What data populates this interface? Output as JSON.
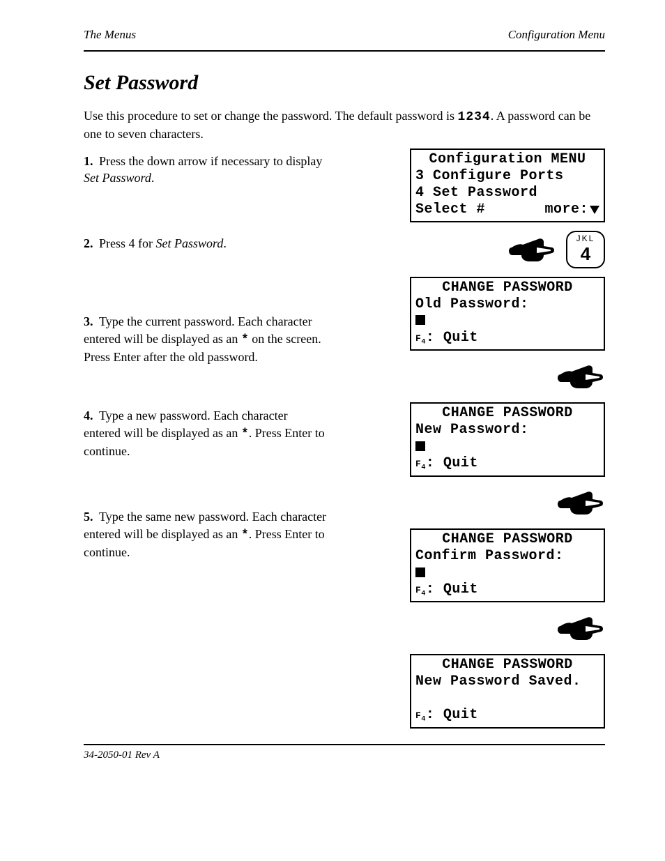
{
  "header": {
    "left": "The Menus",
    "right": "Configuration Menu"
  },
  "heading": "Set Password",
  "intro_before": "Use this procedure to set or change the password. The default password is ",
  "intro_digits": "1234",
  "intro_after": ". A password can be one to seven characters.",
  "steps": [
    {
      "num": "1.",
      "text_a": "Press the down arrow if necessary to display ",
      "italic": "Set Password",
      "text_b": "."
    },
    {
      "num": "2.",
      "text_a": "Press 4 for ",
      "italic": "Set Password",
      "text_b": "."
    },
    {
      "num": "3.",
      "text_a": "Type the current password. Each character entered will be displayed as an ",
      "ast": "*",
      "text_b": " on the screen. Press Enter after the old password."
    },
    {
      "num": "4.",
      "text_a": "Type a new password. Each character entered will be displayed as an ",
      "ast": "*",
      "text_b": ". Press Enter to continue."
    },
    {
      "num": "5.",
      "text_a": "Type the same new password. Each character entered will be displayed as an ",
      "ast": "*",
      "text_b": ". Press Enter to continue."
    }
  ],
  "lcd1": {
    "title": "Configuration MENU",
    "line1": "3 Configure Ports",
    "line2": "4 Set Password",
    "select": "Select #",
    "more": "more:"
  },
  "key4": {
    "letters": "JKL",
    "digit": "4"
  },
  "lcd_cp": {
    "title": "CHANGE PASSWORD",
    "old": "Old Password:",
    "new": "New Password:",
    "confirm": "Confirm Password:",
    "saved": "New Password Saved.",
    "quit": "Quit"
  },
  "footer": "34-2050-01 Rev A"
}
